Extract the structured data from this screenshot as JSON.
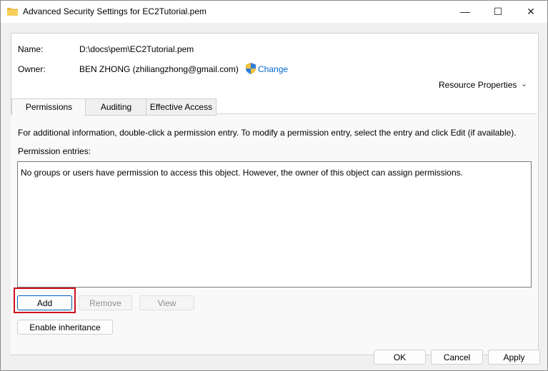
{
  "window": {
    "title": "Advanced Security Settings for EC2Tutorial.pem",
    "controls": {
      "minimize": "—",
      "maximize": "☐",
      "close": "✕"
    }
  },
  "info": {
    "name_label": "Name:",
    "name_value": "D:\\docs\\pem\\EC2Tutorial.pem",
    "owner_label": "Owner:",
    "owner_value": "BEN ZHONG (zhiliangzhong@gmail.com)",
    "change_link": "Change",
    "resource_properties": "Resource Properties"
  },
  "tabs": [
    {
      "label": "Permissions",
      "active": true
    },
    {
      "label": "Auditing",
      "active": false
    },
    {
      "label": "Effective Access",
      "active": false
    }
  ],
  "permissions": {
    "instructions": "For additional information, double-click a permission entry. To modify a permission entry, select the entry and click Edit (if available).",
    "entries_label": "Permission entries:",
    "empty_message": "No groups or users have permission to access this object. However, the owner of this object can assign permissions.",
    "add_button": "Add",
    "remove_button": "Remove",
    "view_button": "View",
    "enable_inheritance_button": "Enable inheritance"
  },
  "footer": {
    "ok_button": "OK",
    "cancel_button": "Cancel",
    "apply_button": "Apply"
  },
  "colors": {
    "link": "#0066cc",
    "highlight": "#d0101b",
    "folder_icon": "#f5c542"
  }
}
